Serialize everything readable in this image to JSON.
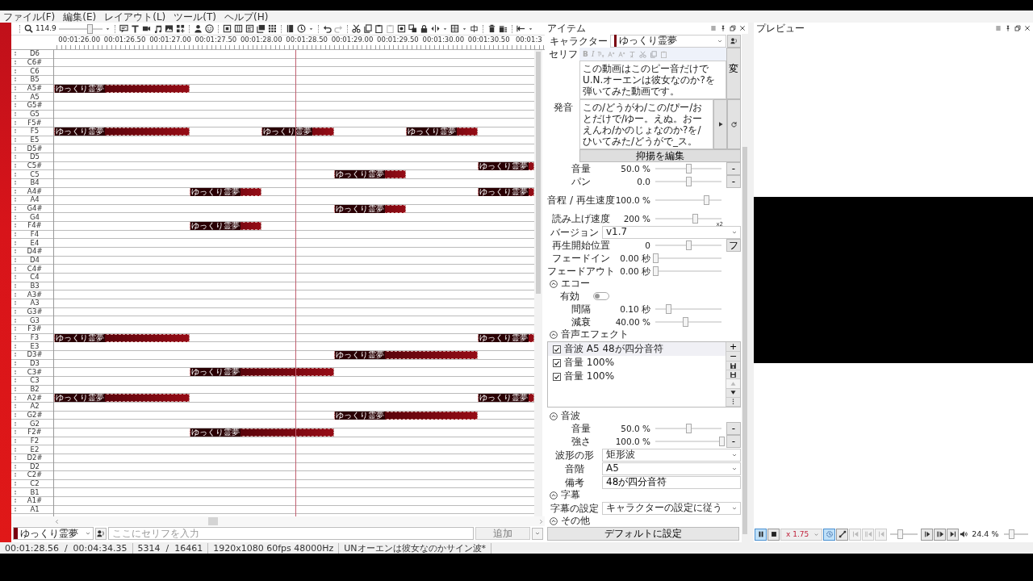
{
  "menu": [
    "ファイル(F)",
    "編集(E)",
    "レイアウト(L)",
    "ツール(T)",
    "ヘルプ(H)"
  ],
  "toolbar": {
    "zoom": "114.9",
    "zoom_slider": {
      "level": 0.7
    }
  },
  "ruler": [
    "00:01:26.00",
    "00:01:26.50",
    "00:01:27.00",
    "00:01:27.50",
    "00:01:28.00",
    "00:01:28.50",
    "00:01:29.00",
    "00:01:29.50",
    "00:01:30.00",
    "00:01:30.50",
    "00:01:3"
  ],
  "piano_roll": {
    "rows": [
      {
        "key": "D6",
        "notes": []
      },
      {
        "key": "C6#",
        "notes": []
      },
      {
        "key": "C6",
        "notes": []
      },
      {
        "key": "B5",
        "notes": []
      },
      {
        "key": "A5#",
        "notes": [
          {
            "label": "ゆっくり霊夢"
          }
        ]
      },
      {
        "key": "A5",
        "notes": []
      },
      {
        "key": "G5#",
        "notes": []
      },
      {
        "key": "G5",
        "notes": []
      },
      {
        "key": "F5#",
        "notes": []
      },
      {
        "key": "F5",
        "notes": [
          {
            "label": "ゆっくり霊夢"
          },
          {
            "label": "ゆっくり霊夢"
          },
          {
            "label": "ゆっくり霊夢"
          }
        ]
      },
      {
        "key": "E5",
        "notes": []
      },
      {
        "key": "D5#",
        "notes": []
      },
      {
        "key": "D5",
        "notes": []
      },
      {
        "key": "C5#",
        "notes": [
          {
            "label": "ゆっくり霊夢"
          }
        ]
      },
      {
        "key": "C5",
        "notes": [
          {
            "label": "ゆっくり霊夢"
          }
        ]
      },
      {
        "key": "B4",
        "notes": []
      },
      {
        "key": "A4#",
        "notes": [
          {
            "label": "ゆっくり霊夢"
          },
          {
            "label": "ゆっくり霊夢"
          }
        ]
      },
      {
        "key": "A4",
        "notes": []
      },
      {
        "key": "G4#",
        "notes": [
          {
            "label": "ゆっくり霊夢"
          }
        ]
      },
      {
        "key": "G4",
        "notes": []
      },
      {
        "key": "F4#",
        "notes": [
          {
            "label": "ゆっくり霊夢"
          }
        ]
      },
      {
        "key": "F4",
        "notes": []
      },
      {
        "key": "E4",
        "notes": []
      },
      {
        "key": "D4#",
        "notes": []
      },
      {
        "key": "D4",
        "notes": []
      },
      {
        "key": "C4#",
        "notes": []
      },
      {
        "key": "C4",
        "notes": []
      },
      {
        "key": "B3",
        "notes": []
      },
      {
        "key": "A3#",
        "notes": []
      },
      {
        "key": "A3",
        "notes": []
      },
      {
        "key": "G3#",
        "notes": []
      },
      {
        "key": "G3",
        "notes": []
      },
      {
        "key": "F3#",
        "notes": []
      },
      {
        "key": "F3",
        "notes": [
          {
            "label": "ゆっくり霊夢"
          },
          {
            "label": "ゆっくり霊夢"
          }
        ]
      },
      {
        "key": "E3",
        "notes": []
      },
      {
        "key": "D3#",
        "notes": [
          {
            "label": "ゆっくり霊夢"
          }
        ]
      },
      {
        "key": "D3",
        "notes": []
      },
      {
        "key": "C3#",
        "notes": [
          {
            "label": "ゆっくり霊夢"
          }
        ]
      },
      {
        "key": "C3",
        "notes": []
      },
      {
        "key": "B2",
        "notes": []
      },
      {
        "key": "A2#",
        "notes": [
          {
            "label": "ゆっくり霊夢"
          },
          {
            "label": "ゆっくり霊夢"
          }
        ]
      },
      {
        "key": "A2",
        "notes": []
      },
      {
        "key": "G2#",
        "notes": [
          {
            "label": "ゆっくり霊夢"
          }
        ]
      },
      {
        "key": "G2",
        "notes": []
      },
      {
        "key": "F2#",
        "notes": [
          {
            "label": "ゆっくり霊夢"
          }
        ]
      },
      {
        "key": "F2",
        "notes": []
      },
      {
        "key": "E2",
        "notes": []
      },
      {
        "key": "D2#",
        "notes": []
      },
      {
        "key": "D2",
        "notes": []
      },
      {
        "key": "C2#",
        "notes": []
      },
      {
        "key": "C2",
        "notes": []
      },
      {
        "key": "B1",
        "notes": []
      },
      {
        "key": "A1#",
        "notes": []
      },
      {
        "key": "A1",
        "notes": []
      }
    ]
  },
  "timeline_input": {
    "character": "ゆっくり霊夢",
    "placeholder": "ここにセリフを入力",
    "add_button": "追加"
  },
  "status_bar": [
    "00:01:28.56  /  00:04:34.35",
    "5314  /  16461",
    "1920x1080 60fps 48000Hz",
    "UNオーエンは彼女なのかサイン波*"
  ],
  "item_panel": {
    "title": "アイテム",
    "character": {
      "label": "キャラクター",
      "value": "ゆっくり霊夢"
    },
    "serif": {
      "label": "セリフ",
      "format_buttons": [
        "B",
        "I"
      ],
      "text": "この動画はこのピー音だけでU.N.オーエンは彼女なのか?を弾いてみた動画です。",
      "button": "変"
    },
    "pronunciation": {
      "label": "発音",
      "text": "この/どうがわ/この/ぴー/おとだけで/ゆー。えぬ。おーえんわ/かのじょなのか?を/ひいてみた/どうがで_ス。"
    },
    "intonation_button": "抑揚を編集",
    "fields": [
      {
        "kind": "slider",
        "label": "音量",
        "reading": "50.0 %",
        "level": 0.5,
        "button": "-"
      },
      {
        "kind": "slider",
        "label": "パン",
        "reading": "0.0",
        "level": 0.5,
        "button": "-"
      },
      {
        "kind": "slider",
        "label": "音程 / 再生速度",
        "reading": "100.0 %",
        "level": 0.77
      },
      {
        "kind": "slider",
        "label": "読み上げ速度",
        "reading": "200 %",
        "level": 0.6,
        "note": "x2"
      },
      {
        "kind": "select",
        "label": "バージョン",
        "value": "v1.7"
      },
      {
        "kind": "slider",
        "label": "再生開始位置",
        "reading": "0",
        "level": 0.5,
        "button": "フ"
      },
      {
        "kind": "slider",
        "label": "フェードイン",
        "reading": "0.00 秒",
        "level": 0
      },
      {
        "kind": "slider",
        "label": "フェードアウト",
        "reading": "0.00 秒",
        "level": 0
      },
      {
        "kind": "section",
        "label": "エコー",
        "expanded": true
      },
      {
        "kind": "toggle",
        "label": "有効",
        "on": false
      },
      {
        "kind": "slider",
        "label": "間隔",
        "reading": "0.10 秒",
        "level": 0.2
      },
      {
        "kind": "slider",
        "label": "減衰",
        "reading": "40.00 %",
        "level": 0.45
      },
      {
        "kind": "section",
        "label": "音声エフェクト",
        "expanded": true
      },
      {
        "kind": "effects",
        "add": "+",
        "remove": "−",
        "items": [
          {
            "label": "音波 A5 48が四分音符",
            "checked": true,
            "selected": true
          },
          {
            "label": "音量 100%",
            "checked": true,
            "selected": false
          },
          {
            "label": "音量 100%",
            "checked": true,
            "selected": false
          }
        ]
      },
      {
        "kind": "section",
        "label": "音波",
        "expanded": true
      },
      {
        "kind": "slider",
        "label": "音量",
        "reading": "50.0 %",
        "level": 0.5,
        "button": "-"
      },
      {
        "kind": "slider",
        "label": "強さ",
        "reading": "100.0 %",
        "level": 1,
        "button": "-"
      },
      {
        "kind": "select",
        "label": "波形の形",
        "value": "矩形波"
      },
      {
        "kind": "select",
        "label": "音階",
        "value": "A5"
      },
      {
        "kind": "input",
        "label": "備考",
        "value": "48が四分音符"
      },
      {
        "kind": "section",
        "label": "字幕",
        "expanded": true
      },
      {
        "kind": "select",
        "label": "字幕の設定",
        "value": "キャラクターの設定に従う"
      },
      {
        "kind": "section",
        "label": "その他",
        "expanded": true
      }
    ],
    "footer_button": "デフォルトに設定"
  },
  "preview": {
    "title": "プレビュー",
    "controls": [
      {
        "kind": "button",
        "selected": true,
        "disabled": false
      },
      {
        "kind": "button",
        "selected": false,
        "disabled": false
      },
      {
        "kind": "select",
        "value": "x 1.75"
      },
      {
        "kind": "button",
        "selected": true,
        "disabled": false
      },
      {
        "kind": "button",
        "selected": false,
        "disabled": false
      },
      {
        "kind": "button",
        "selected": false,
        "disabled": true
      },
      {
        "kind": "button",
        "selected": false,
        "disabled": true
      },
      {
        "kind": "button",
        "selected": false,
        "disabled": true
      },
      {
        "kind": "slider",
        "level": 0.35
      },
      {
        "kind": "button",
        "selected": false,
        "disabled": false
      },
      {
        "kind": "button",
        "selected": false,
        "disabled": false
      },
      {
        "kind": "button",
        "selected": false,
        "disabled": false
      },
      {
        "kind": "reading",
        "text": "24.4 %"
      },
      {
        "kind": "slider",
        "level": 0.3
      }
    ]
  }
}
